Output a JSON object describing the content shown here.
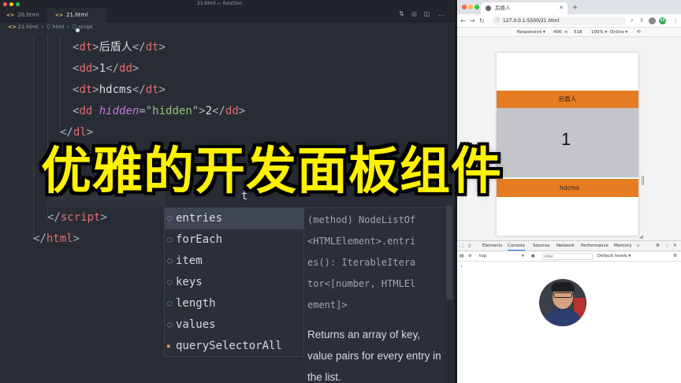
{
  "window": {
    "title": "21.html — function"
  },
  "editor": {
    "tabs": [
      {
        "label": "20.html",
        "icon": "<>"
      },
      {
        "label": "21.html",
        "icon": "<>",
        "modified": true
      }
    ],
    "breadcrumb": [
      "21.html",
      "html",
      "script"
    ],
    "code": {
      "line1": {
        "tag": "dt",
        "text": "后盾人"
      },
      "line2": {
        "tag": "dd",
        "text": "1"
      },
      "line3": {
        "tag": "dt",
        "text": "hdcms"
      },
      "line4": {
        "tag": "dd",
        "attr": "hidden",
        "value": "hidden",
        "text": "2"
      },
      "line5": {
        "tag": "dl"
      },
      "partial": "t",
      "script_close": "script",
      "html_close": "html"
    },
    "autocomplete": {
      "items": [
        "entries",
        "forEach",
        "item",
        "keys",
        "length",
        "values",
        "querySelectorAll"
      ],
      "selected": "entries",
      "doc_signature": [
        "(method) NodeListOf",
        "<HTMLElement>.entri",
        "es(): IterableItera",
        "tor<[number, HTMLEl",
        "ement]>"
      ],
      "doc_description": [
        "Returns an array of key,",
        "value pairs for every entry in",
        "the list."
      ]
    }
  },
  "browser": {
    "tab_title": "后盾人",
    "url": "127.0.0.1:5500/21.html",
    "profile_badge": "88",
    "device_toolbar": {
      "mode": "Responsive ▾",
      "width": "400",
      "times": "×",
      "height": "518",
      "zoom": "100% ▾",
      "network": "Online ▾"
    },
    "page": {
      "dt1": "后盾人",
      "dd1": "1",
      "dt2": "hdcms"
    },
    "devtools": {
      "tabs": [
        "Elements",
        "Console",
        "Sources",
        "Network",
        "Performance",
        "Memory",
        "»"
      ],
      "active_tab": "Console",
      "context": "top",
      "filter_placeholder": "Filter",
      "levels": "Default levels ▾",
      "prompt": "›"
    }
  },
  "overlay_title": "优雅的开发面板组件",
  "colors": {
    "editor_bg": "#282c34",
    "tag": "#e06c75",
    "attr": "#c678dd",
    "string": "#98c379",
    "orange_bar": "#e67c22",
    "title_yellow": "#fff200"
  }
}
